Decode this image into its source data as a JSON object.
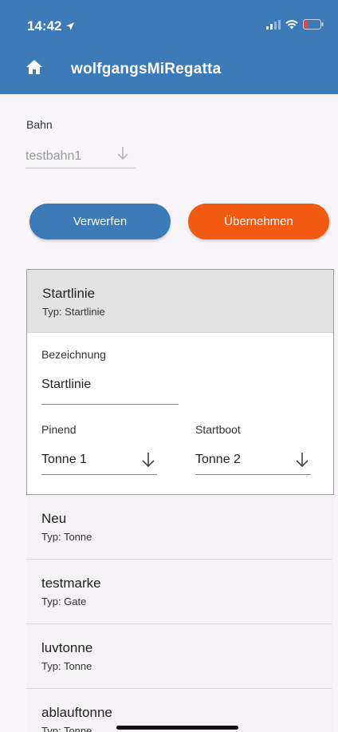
{
  "status_bar": {
    "time": "14:42"
  },
  "app_bar": {
    "title": "wolfgangsMiRegatta"
  },
  "bahn": {
    "label": "Bahn",
    "value": "testbahn1"
  },
  "buttons": {
    "discard": "Verwerfen",
    "apply": "Übernehmen"
  },
  "expanded_item": {
    "title": "Startlinie",
    "subtitle": "Typ: Startlinie",
    "bezeichnung_label": "Bezeichnung",
    "bezeichnung_value": "Startlinie",
    "pinend_label": "Pinend",
    "pinend_value": "Tonne 1",
    "startboot_label": "Startboot",
    "startboot_value": "Tonne 2"
  },
  "items": [
    {
      "title": "Neu",
      "subtitle": "Typ: Tonne"
    },
    {
      "title": "testmarke",
      "subtitle": "Typ: Gate"
    },
    {
      "title": "luvtonne",
      "subtitle": "Typ: Tonne"
    },
    {
      "title": "ablauftonne",
      "subtitle": "Typ: Tonne"
    }
  ],
  "colors": {
    "primary": "#3d7ab8",
    "accent": "#f25a12"
  }
}
